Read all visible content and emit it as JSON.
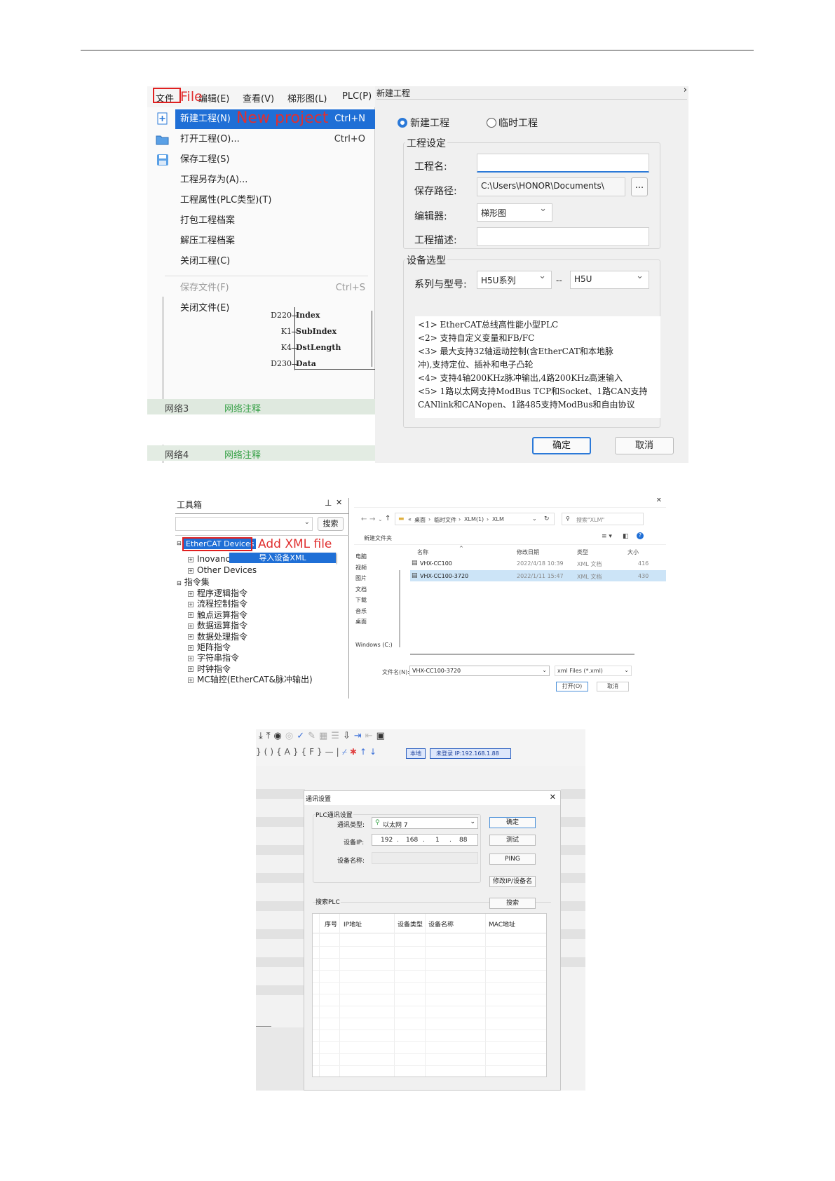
{
  "s1": {
    "menubar": [
      "文件",
      "编辑(E)",
      "查看(V)",
      "梯形图(L)",
      "PLC(P)"
    ],
    "file_annot": "File",
    "new_annot": "New project",
    "menu": [
      {
        "label": "新建工程(N)",
        "shortcut": "Ctrl+N"
      },
      {
        "label": "打开工程(O)...",
        "shortcut": "Ctrl+O"
      },
      {
        "label": "保存工程(S)",
        "shortcut": ""
      },
      {
        "label": "工程另存为(A)...",
        "shortcut": ""
      },
      {
        "label": "工程属性(PLC类型)(T)",
        "shortcut": ""
      },
      {
        "label": "打包工程档案",
        "shortcut": ""
      },
      {
        "label": "解压工程档案",
        "shortcut": ""
      },
      {
        "label": "关闭工程(C)",
        "shortcut": ""
      },
      {
        "label": "保存文件(F)",
        "shortcut": "Ctrl+S"
      },
      {
        "label": "关闭文件(E)",
        "shortcut": ""
      }
    ],
    "ladder": [
      {
        "reg": "D220",
        "name": "Index"
      },
      {
        "reg": "K1",
        "name": "SubIndex"
      },
      {
        "reg": "K4",
        "name": "DstLength"
      },
      {
        "reg": "D230",
        "name": "Data"
      }
    ],
    "networks": [
      {
        "name": "网络3",
        "comment": "网络注释"
      },
      {
        "name": "网络4",
        "comment": "网络注释"
      }
    ],
    "dialog": {
      "title": "新建工程",
      "radio_new": "新建工程",
      "radio_temp": "临时工程",
      "group_project": "工程设定",
      "name_label": "工程名:",
      "name_value": "",
      "path_label": "保存路径:",
      "path_value": "C:\\Users\\HONOR\\Documents\\",
      "browse": "...",
      "editor_label": "编辑器:",
      "editor_value": "梯形图",
      "desc_label": "工程描述:",
      "desc_value": "",
      "group_device": "设备选型",
      "series_label": "系列与型号:",
      "series_value": "H5U系列",
      "dash": "--",
      "model_value": "H5U",
      "description": [
        "<1> EtherCAT总线高性能小型PLC",
        "<2> 支持自定义变量和FB/FC",
        "<3> 最大支持32轴运动控制(含EtherCAT和本地脉",
        "冲),支持定位、插补和电子凸轮",
        "<4> 支持4轴200KHz脉冲输出,4路200KHz高速输入",
        "<5> 1路以太网支持ModBus TCP和Socket、1路CAN支持",
        "CANlink和CANopen、1路485支持ModBus和自由协议"
      ],
      "ok": "确定",
      "cancel": "取消"
    }
  },
  "s2": {
    "toolbox_title": "工具箱",
    "pin": "ᵖ",
    "close": "✕",
    "search_button": "搜索",
    "ethercat": "EtherCAT Devices",
    "add_annot": "Add XML file",
    "context_item": "导入设备XML",
    "tree_top": [
      "Inovance",
      "Other Devices"
    ],
    "instr_root": "指令集",
    "instructions": [
      "程序逻辑指令",
      "流程控制指令",
      "触点运算指令",
      "数据运算指令",
      "数据处理指令",
      "矩阵指令",
      "字符串指令",
      "时钟指令",
      "MC轴控(EtherCAT&脉冲输出)"
    ],
    "path": [
      "桌面",
      "临时文件",
      "XLM(1)",
      "XLM"
    ],
    "search_ph": "搜索\"XLM\"",
    "new_folder": "新建文件夹",
    "cols": [
      "名称",
      "修改日期",
      "类型",
      "大小"
    ],
    "files": [
      {
        "name": "VHX-CC100",
        "date": "2022/4/18 10:39",
        "type": "XML 文档",
        "size": "416"
      },
      {
        "name": "VHX-CC100-3720",
        "date": "2022/1/11 15:47",
        "type": "XML 文档",
        "size": "430"
      }
    ],
    "sidebar": [
      "电脑",
      "视频",
      "图片",
      "文档",
      "下载",
      "音乐",
      "桌面",
      "Windows (C:)"
    ],
    "filename_label": "文件名(N):",
    "filename_value": "VHX-CC100-3720",
    "filter": "xml Files (*.xml)",
    "open": "打开(O)",
    "cancel": "取消",
    "close_x": "✕"
  },
  "s3": {
    "local_badge": "本地",
    "login_badge": "未登录 IP:192.168.1.88",
    "dialog_title": "通讯设置",
    "close": "✕",
    "group_plc": "PLC通讯设置",
    "type_label": "通讯类型:",
    "type_value": "以太网 7",
    "ip_label": "设备IP:",
    "ip": [
      "192",
      "168",
      "1",
      "88"
    ],
    "name_label": "设备名称:",
    "btn_ok": "确定",
    "btn_test": "测试",
    "btn_ping": "PING",
    "btn_modify": "修改IP/设备名",
    "group_search": "搜索PLC",
    "btn_search": "搜索",
    "cols": [
      "序号",
      "IP地址",
      "设备类型",
      "设备名称",
      "MAC地址"
    ]
  }
}
